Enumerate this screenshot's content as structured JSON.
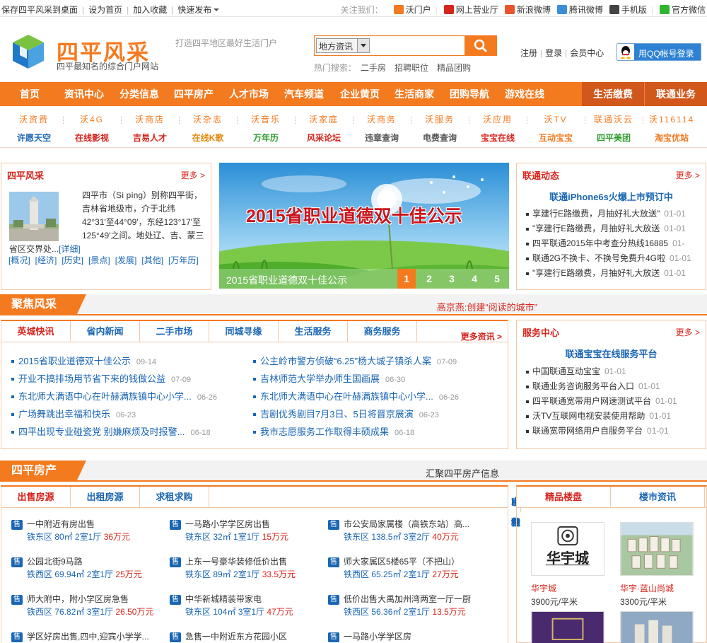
{
  "topbar": {
    "links": [
      "保存四平风采到桌面",
      "设为首页",
      "加入收藏",
      "快速发布"
    ],
    "follow_label": "关注我们：",
    "brands": [
      {
        "label": "沃门户",
        "icon": "wo-icon",
        "color": "#f47a20"
      },
      {
        "label": "网上营业厅",
        "icon": "unicom-icon",
        "color": "#d6251d"
      },
      {
        "label": "新浪微博",
        "icon": "weibo-icon",
        "color": "#e8542b"
      },
      {
        "label": "腾讯微博",
        "icon": "tencent-weibo-icon",
        "color": "#3a8fd8"
      },
      {
        "label": "手机版",
        "icon": "mobile-icon",
        "color": "#444444"
      },
      {
        "label": "官方微信",
        "icon": "wechat-icon",
        "color": "#2fb52f"
      }
    ]
  },
  "header": {
    "logo_name": "四平风采",
    "logo_sub": "四平最知名的综合门户网站",
    "tagline": "打造四平地区最好生活门户",
    "search_select": "地方资讯",
    "search_placeholder": "",
    "hot_label": "热门搜索：",
    "hot_links": [
      "二手房",
      "招聘职位",
      "精品团购"
    ],
    "member_links": [
      "注册",
      "登录",
      "会员中心"
    ],
    "qq_label": "用QQ帐号登录"
  },
  "nav": {
    "items": [
      "首页",
      "资讯中心",
      "分类信息",
      "四平房产",
      "人才市场",
      "汽车频道",
      "企业黄页",
      "生活商家",
      "团购导航",
      "游戏在线"
    ],
    "dark_items": [
      "生活缴费",
      "联通业务"
    ]
  },
  "linkgrid": {
    "row1": [
      "沃资费",
      "沃4G",
      "沃商店",
      "沃杂志",
      "沃音乐",
      "沃家庭",
      "沃商务",
      "沃服务",
      "沃应用",
      "沃TV",
      "联通沃云",
      "沃116114"
    ],
    "row2": [
      {
        "label": "许愿天空",
        "color": "#1a66b3"
      },
      {
        "label": "在线影视",
        "color": "#d6251d"
      },
      {
        "label": "吉易人才",
        "color": "#d6251d"
      },
      {
        "label": "在线K歌",
        "color": "#e08a0c"
      },
      {
        "label": "万年历",
        "color": "#2d9c2d"
      },
      {
        "label": "风采论坛",
        "color": "#d6251d"
      },
      {
        "label": "违章查询",
        "color": "#555555"
      },
      {
        "label": "电费查询",
        "color": "#555555"
      },
      {
        "label": "宝宝在线",
        "color": "#d6251d"
      },
      {
        "label": "互动宝宝",
        "color": "#f47a20"
      },
      {
        "label": "四平美团",
        "color": "#2d9c2d"
      },
      {
        "label": "淘宝优站",
        "color": "#f47a20"
      }
    ]
  },
  "intro": {
    "title": "四平风采",
    "more": "更多 >",
    "text": "四平市（Sì píng）别称四平街，吉林省地级市，介于北纬42°31'至44°09'，东经123°17'至125°49'之间。地处辽、吉、蒙三省区交界处...",
    "detail": "[详细]",
    "tags": [
      "[概况]",
      "[经济]",
      "[历史]",
      "[景点]",
      "[发展]",
      "[其他]",
      "[万年历]"
    ]
  },
  "banner": {
    "title": "2015省职业道德双十佳公示",
    "caption": "2015省职业道德双十佳公示",
    "pages": [
      "1",
      "2",
      "3",
      "4",
      "5"
    ],
    "active_page": "1"
  },
  "unicom_news": {
    "title": "联通动态",
    "more": "更多 >",
    "headline": "联通iPhone6s火爆上市预订中",
    "items": [
      {
        "text": "享建行E路缴费，月抽好礼大放送\"",
        "date": "01-01"
      },
      {
        "text": "\"享建行E路缴费，月抽好礼大放送",
        "date": "01-01"
      },
      {
        "text": "四平联通2015年中考查分热线16885",
        "date": "01-"
      },
      {
        "text": "联通2G不换卡、不换号免费升4G啦",
        "date": "01-01"
      },
      {
        "text": "\"享建行E路缴费，月抽好礼大放送",
        "date": "01-01"
      }
    ]
  },
  "focus_bar": {
    "label": "聚焦风采",
    "right": "高京燕:创建“阅读的城市”"
  },
  "news_panel": {
    "tabs": [
      "英城快讯",
      "省内新闻",
      "二手市场",
      "同城寻缘",
      "生活服务",
      "商务服务"
    ],
    "active_tab": "英城快讯",
    "more": "更多资讯 >",
    "col1": [
      {
        "text": "2015省职业道德双十佳公示",
        "date": "09-14"
      },
      {
        "text": "开业不搞排场用节省下来的钱做公益",
        "date": "07-09"
      },
      {
        "text": "东北师大满语中心在叶赫满族镇中心小学...",
        "date": "06-26"
      },
      {
        "text": "广场舞跳出幸福和快乐",
        "date": "06-23"
      },
      {
        "text": "四平出现专业碰瓷党  别嫌麻烦及时报警...",
        "date": "06-18"
      }
    ],
    "col2": [
      {
        "text": "公主岭市警方侦破“6.25”杨大城子镇杀人案",
        "date": "07-09"
      },
      {
        "text": "吉林师范大学举办师生国画展",
        "date": "06-30"
      },
      {
        "text": "东北师大满语中心在叶赫满族镇中心小学...",
        "date": "06-26"
      },
      {
        "text": "吉剧优秀剧目7月3日、5日将晋京展演",
        "date": "06-23"
      },
      {
        "text": "我市志愿服务工作取得丰硕成果",
        "date": "06-18"
      }
    ]
  },
  "service_center": {
    "title": "服务中心",
    "more": "更多 >",
    "headline": "联通宝宝在线服务平台",
    "items": [
      {
        "text": "中国联通互动宝宝",
        "date": "01-01"
      },
      {
        "text": "联通业务咨询服务平台入口",
        "date": "01-01"
      },
      {
        "text": "四平联通宽带用户网速测试平台",
        "date": "01-01"
      },
      {
        "text": "沃TV互联网电视安装使用帮助",
        "date": "01-01"
      },
      {
        "text": "联通宽带网络用户自服务平台",
        "date": "01-01"
      }
    ]
  },
  "house_bar": {
    "label": "四平房产",
    "right": "汇聚四平房产信息"
  },
  "house_panel": {
    "tabs": [
      "出售房源",
      "出租房源",
      "求租求购"
    ],
    "active_tab": "出售房源",
    "sublinks": [
      "出租",
      "出售",
      "求租",
      "求购",
      "中介"
    ],
    "badge": "售",
    "listings": [
      {
        "title": "一中附近有房出售",
        "meta": "铁东区 80㎡ 2室1厅",
        "price": "36万元"
      },
      {
        "title": "一马路小学学区房出售",
        "meta": "铁东区 32㎡ 1室1厅",
        "price": "15万元"
      },
      {
        "title": "市公安局家属楼（高铁东站）高...",
        "meta": "铁东区 138.5㎡ 3室2厅",
        "price": "40万元"
      },
      {
        "title": "公园北街9马路",
        "meta": "铁西区 69.94㎡ 2室1厅",
        "price": "25万元"
      },
      {
        "title": "上东一号豪华装修低价出售",
        "meta": "铁东区 89㎡ 2室1厅",
        "price": "33.5万元"
      },
      {
        "title": "师大家属区5楼65平（不把山）",
        "meta": "铁西区 65.25㎡ 2室1厅",
        "price": "27万元"
      },
      {
        "title": "师大附中，附小学区房急售",
        "meta": "铁西区 76.82㎡ 3室1厅",
        "price": "26.50万元"
      },
      {
        "title": "中华新城精装带家电",
        "meta": "铁东区 104㎡ 3室1厅",
        "price": "47万元"
      },
      {
        "title": "低价出售大禹加州湾两室一厅一厨",
        "meta": "铁西区 56.36㎡ 2室1厅",
        "price": "13.5万元"
      },
      {
        "title": "学区好房出售,四中,迎宾小学学...",
        "meta": "",
        "price": ""
      },
      {
        "title": "急售一中附近东方花园小区",
        "meta": "",
        "price": ""
      },
      {
        "title": "一马路小学学区房",
        "meta": "",
        "price": ""
      }
    ]
  },
  "props_panel": {
    "tabs": [
      "精品楼盘",
      "楼市资讯"
    ],
    "active_tab": "精品楼盘",
    "cards": [
      {
        "name": "华宇城",
        "price": "3900元/平米",
        "logo_text": "华宇城"
      },
      {
        "name": "华宇·蓝山尚城",
        "price": "3300元/平米",
        "logo_text": ""
      }
    ]
  }
}
